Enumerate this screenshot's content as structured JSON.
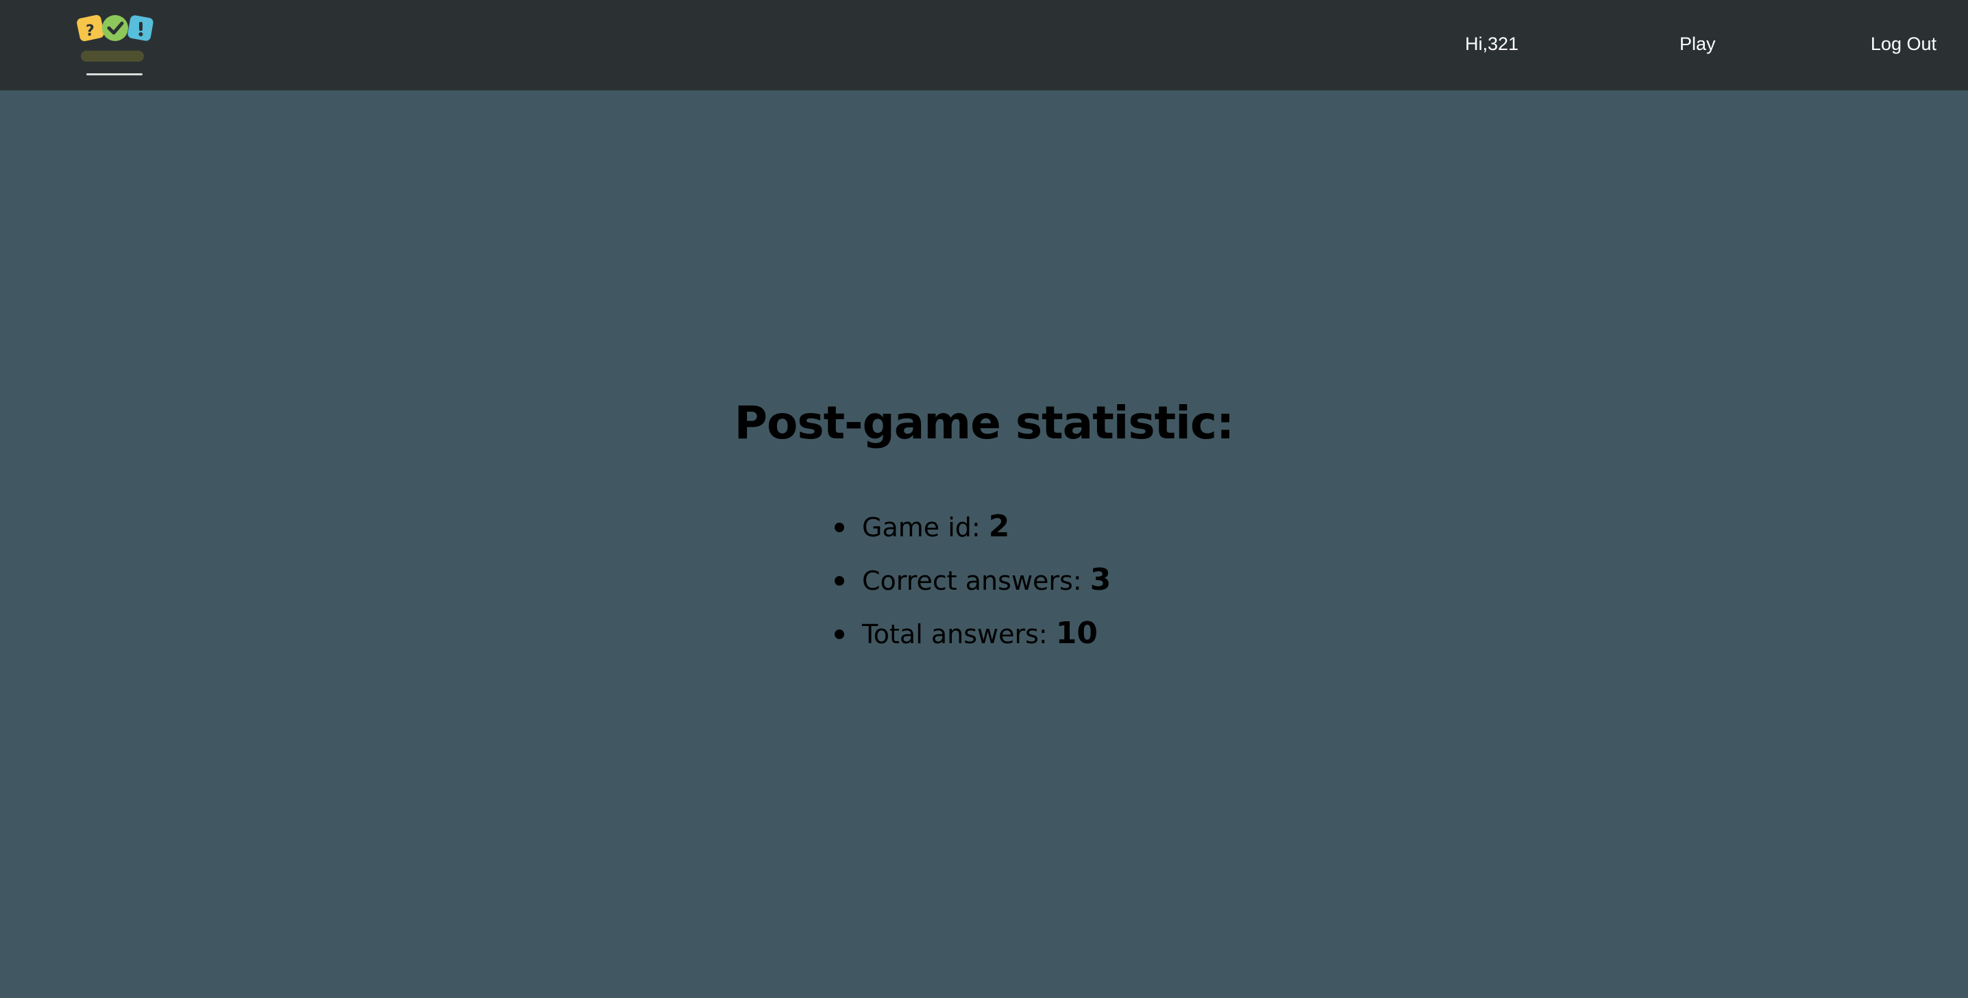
{
  "navbar": {
    "logo_icon": "quiz-logo-icon",
    "greeting": "Hi,321",
    "play_label": "Play",
    "logout_label": "Log Out"
  },
  "stats": {
    "title": "Post-game statistic:",
    "items": [
      {
        "label": "Game id: ",
        "value": "2"
      },
      {
        "label": "Correct answers: ",
        "value": "3"
      },
      {
        "label": "Total answers: ",
        "value": "10"
      }
    ]
  },
  "colors": {
    "navbar_background": "#2b3133",
    "page_background": "#415862",
    "nav_text": "#ffffff",
    "content_text": "#000000",
    "logo_yellow": "#f7c54a",
    "logo_green": "#8dc85a",
    "logo_blue": "#57bedb"
  }
}
